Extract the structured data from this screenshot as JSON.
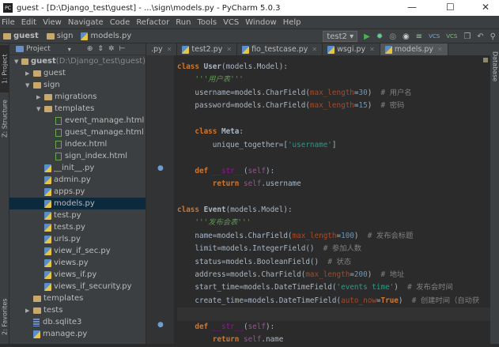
{
  "window": {
    "title": "guest - [D:\\Django_test\\guest] - ...\\sign\\models.py - PyCharm 5.0.3",
    "logo": "PC",
    "minimize": "—",
    "maximize": "☐",
    "close": "✕"
  },
  "menu": [
    "File",
    "Edit",
    "View",
    "Navigate",
    "Code",
    "Refactor",
    "Run",
    "Tools",
    "VCS",
    "Window",
    "Help"
  ],
  "breadcrumb": [
    "guest",
    "sign",
    "models.py"
  ],
  "toolbar": {
    "run_config": "test2 ▾",
    "icons": [
      "run-icon",
      "debug-icon",
      "coverage-icon",
      "profile-icon",
      "concurrency-icon",
      "vcs-update-icon",
      "vcs-commit-icon",
      "compare-icon",
      "revert-icon",
      "search-icon"
    ]
  },
  "left_stripe": {
    "project": "1: Project",
    "structure": "Z: Structure",
    "favorites": "2: Favorites"
  },
  "right_stripe": {
    "database": "Database"
  },
  "project": {
    "header": "Project",
    "tree": [
      {
        "label": "guest",
        "extra": " (D:\\Django_test\\guest)",
        "type": "folder",
        "depth": 0,
        "arrow": "▼",
        "bold": true
      },
      {
        "label": "guest",
        "type": "folder",
        "depth": 1,
        "arrow": "▶"
      },
      {
        "label": "sign",
        "type": "folder",
        "depth": 1,
        "arrow": "▼"
      },
      {
        "label": "migrations",
        "type": "folder",
        "depth": 2,
        "arrow": "▶"
      },
      {
        "label": "templates",
        "type": "folder",
        "depth": 2,
        "arrow": "▼"
      },
      {
        "label": "event_manage.html",
        "type": "html",
        "depth": 3
      },
      {
        "label": "guest_manage.html",
        "type": "html",
        "depth": 3
      },
      {
        "label": "index.html",
        "type": "html",
        "depth": 3
      },
      {
        "label": "sign_index.html",
        "type": "html",
        "depth": 3
      },
      {
        "label": "__init__.py",
        "type": "py",
        "depth": 2
      },
      {
        "label": "admin.py",
        "type": "py",
        "depth": 2
      },
      {
        "label": "apps.py",
        "type": "py",
        "depth": 2
      },
      {
        "label": "models.py",
        "type": "py",
        "depth": 2,
        "selected": true
      },
      {
        "label": "test.py",
        "type": "py",
        "depth": 2
      },
      {
        "label": "tests.py",
        "type": "py",
        "depth": 2
      },
      {
        "label": "urls.py",
        "type": "py",
        "depth": 2
      },
      {
        "label": "view_if_sec.py",
        "type": "py",
        "depth": 2
      },
      {
        "label": "views.py",
        "type": "py",
        "depth": 2
      },
      {
        "label": "views_if.py",
        "type": "py",
        "depth": 2
      },
      {
        "label": "views_if_security.py",
        "type": "py",
        "depth": 2
      },
      {
        "label": "templates",
        "type": "folder",
        "depth": 1
      },
      {
        "label": "tests",
        "type": "folder",
        "depth": 1,
        "arrow": "▶"
      },
      {
        "label": "db.sqlite3",
        "type": "db",
        "depth": 1
      },
      {
        "label": "manage.py",
        "type": "py",
        "depth": 1
      }
    ]
  },
  "tabs": [
    {
      "label": ".py"
    },
    {
      "label": "test2.py"
    },
    {
      "label": "fio_testcase.py"
    },
    {
      "label": "wsgi.py"
    },
    {
      "label": "models.py",
      "active": true
    }
  ],
  "code": [
    [
      [
        "class ",
        "kw"
      ],
      [
        "User",
        "cls"
      ],
      [
        "(models.Model):",
        ""
      ]
    ],
    [
      [
        "    ",
        ""
      ],
      [
        "'''用户表'''",
        "doc"
      ]
    ],
    [
      [
        "    username=models.CharField(",
        ""
      ],
      [
        "max_length",
        "arg"
      ],
      [
        "=",
        ""
      ],
      [
        "30",
        "num"
      ],
      [
        ")  ",
        ""
      ],
      [
        "# 用户名",
        "cm"
      ]
    ],
    [
      [
        "    password=models.CharField(",
        ""
      ],
      [
        "max_length",
        "arg"
      ],
      [
        "=",
        ""
      ],
      [
        "15",
        "num"
      ],
      [
        ")  ",
        ""
      ],
      [
        "# 密码",
        "cm"
      ]
    ],
    [],
    [
      [
        "    ",
        ""
      ],
      [
        "class ",
        "kw"
      ],
      [
        "Meta",
        "cls"
      ],
      [
        ":",
        ""
      ]
    ],
    [
      [
        "        unique_together=[",
        ""
      ],
      [
        "'username'",
        "str"
      ],
      [
        "]",
        ""
      ]
    ],
    [],
    [
      [
        "    ",
        ""
      ],
      [
        "def ",
        "kw"
      ],
      [
        "__str__",
        "mg"
      ],
      [
        "(",
        ""
      ],
      [
        "self",
        "slf"
      ],
      [
        "):",
        ""
      ]
    ],
    [
      [
        "        ",
        ""
      ],
      [
        "return ",
        "kw"
      ],
      [
        "self",
        "slf"
      ],
      [
        ".username",
        ""
      ]
    ],
    [],
    [
      [
        "class ",
        "kw"
      ],
      [
        "Event",
        "cls"
      ],
      [
        "(models.Model):",
        ""
      ]
    ],
    [
      [
        "    ",
        ""
      ],
      [
        "'''发布会表'''",
        "doc"
      ]
    ],
    [
      [
        "    name=models.CharField(",
        ""
      ],
      [
        "max_length",
        "arg"
      ],
      [
        "=",
        ""
      ],
      [
        "100",
        "num"
      ],
      [
        ")  ",
        ""
      ],
      [
        "# 发布会标题",
        "cm"
      ]
    ],
    [
      [
        "    limit=models.IntegerField()  ",
        ""
      ],
      [
        "# 参加人数",
        "cm"
      ]
    ],
    [
      [
        "    status=models.BooleanField()  ",
        ""
      ],
      [
        "# 状态",
        "cm"
      ]
    ],
    [
      [
        "    address=models.CharField(",
        ""
      ],
      [
        "max_length",
        "arg"
      ],
      [
        "=",
        ""
      ],
      [
        "200",
        "num"
      ],
      [
        ")  ",
        ""
      ],
      [
        "# 地址",
        "cm"
      ]
    ],
    [
      [
        "    start_time=models.DateTimeField(",
        ""
      ],
      [
        "'events time'",
        "str"
      ],
      [
        ")  ",
        ""
      ],
      [
        "# 发布会时间",
        "cm"
      ]
    ],
    [
      [
        "    create_time=models.DateTimeField(",
        ""
      ],
      [
        "auto_now",
        "arg"
      ],
      [
        "=",
        ""
      ],
      [
        "True",
        "kw"
      ],
      [
        ")  ",
        ""
      ],
      [
        "# 创建时间（自动获",
        "cm"
      ]
    ],
    [],
    [
      [
        "    ",
        ""
      ],
      [
        "def ",
        "kw"
      ],
      [
        "__str__",
        "mg"
      ],
      [
        "(",
        ""
      ],
      [
        "self",
        "slf"
      ],
      [
        "):",
        ""
      ]
    ],
    [
      [
        "        ",
        ""
      ],
      [
        "return ",
        "kw"
      ],
      [
        "self",
        "slf"
      ],
      [
        ".name",
        ""
      ]
    ]
  ],
  "cursor_line": 19
}
